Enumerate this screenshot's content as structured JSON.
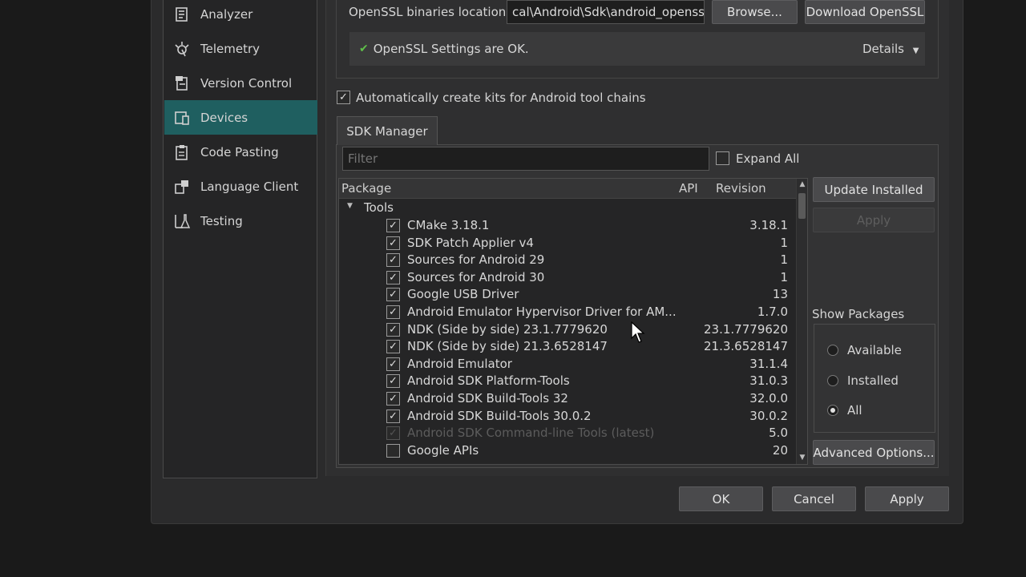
{
  "sidebar": {
    "items": [
      {
        "label": "Analyzer",
        "icon": "analyzer-icon"
      },
      {
        "label": "Telemetry",
        "icon": "telemetry-icon"
      },
      {
        "label": "Version Control",
        "icon": "version-control-icon"
      },
      {
        "label": "Devices",
        "icon": "devices-icon",
        "active": true
      },
      {
        "label": "Code Pasting",
        "icon": "code-pasting-icon"
      },
      {
        "label": "Language Client",
        "icon": "language-client-icon"
      },
      {
        "label": "Testing",
        "icon": "testing-icon"
      }
    ]
  },
  "openssl": {
    "location_label": "OpenSSL binaries location:",
    "location_value": "cal\\Android\\Sdk\\android_openssl",
    "browse_label": "Browse...",
    "download_label": "Download OpenSSL",
    "status_text": "OpenSSL Settings are OK.",
    "details_label": "Details"
  },
  "auto_kits": {
    "label": "Automatically create kits for Android tool chains",
    "checked": true
  },
  "sdk_manager": {
    "tab_label": "SDK Manager",
    "filter_placeholder": "Filter",
    "expand_all_label": "Expand All",
    "columns": {
      "package": "Package",
      "api": "API",
      "revision": "Revision"
    },
    "group_label": "Tools",
    "packages": [
      {
        "name": "CMake 3.18.1",
        "revision": "3.18.1",
        "checked": true
      },
      {
        "name": "SDK Patch Applier v4",
        "revision": "1",
        "checked": true
      },
      {
        "name": "Sources for Android 29",
        "revision": "1",
        "checked": true
      },
      {
        "name": "Sources for Android 30",
        "revision": "1",
        "checked": true
      },
      {
        "name": "Google USB Driver",
        "revision": "13",
        "checked": true
      },
      {
        "name": "Android Emulator Hypervisor Driver for AM...",
        "revision": "1.7.0",
        "checked": true
      },
      {
        "name": "NDK (Side by side) 23.1.7779620",
        "revision": "23.1.7779620",
        "checked": true
      },
      {
        "name": "NDK (Side by side) 21.3.6528147",
        "revision": "21.3.6528147",
        "checked": true
      },
      {
        "name": "Android Emulator",
        "revision": "31.1.4",
        "checked": true
      },
      {
        "name": "Android SDK Platform-Tools",
        "revision": "31.0.3",
        "checked": true
      },
      {
        "name": "Android SDK Build-Tools 32",
        "revision": "32.0.0",
        "checked": true
      },
      {
        "name": "Android SDK Build-Tools 30.0.2",
        "revision": "30.0.2",
        "checked": true
      },
      {
        "name": "Android SDK Command-line Tools (latest)",
        "revision": "5.0",
        "checked": true,
        "disabled": true
      },
      {
        "name": "Google APIs",
        "revision": "20",
        "checked": false
      }
    ],
    "update_installed_label": "Update Installed",
    "apply_label": "Apply",
    "show_packages_label": "Show Packages",
    "show_options": [
      {
        "label": "Available",
        "selected": false
      },
      {
        "label": "Installed",
        "selected": false
      },
      {
        "label": "All",
        "selected": true
      }
    ],
    "advanced_options_label": "Advanced Options..."
  },
  "footer": {
    "ok_label": "OK",
    "cancel_label": "Cancel",
    "apply_label": "Apply"
  }
}
